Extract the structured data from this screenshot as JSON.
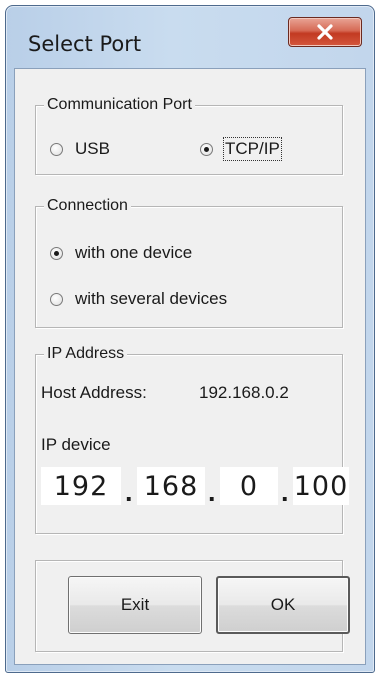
{
  "window": {
    "title": "Select Port"
  },
  "communication": {
    "legend": "Communication Port",
    "usb_label": "USB",
    "tcpip_label": "TCP/IP",
    "selected": "TCP/IP"
  },
  "connection": {
    "legend": "Connection",
    "one_device_label": "with one device",
    "several_devices_label": "with several devices",
    "selected": "with one device"
  },
  "ip_address": {
    "legend": "IP Address",
    "host_label": "Host Address:",
    "host_value": "192.168.0.2",
    "device_label": "IP device",
    "octets": [
      "192",
      "168",
      "0",
      "100"
    ],
    "separator": "."
  },
  "buttons": {
    "exit_label": "Exit",
    "ok_label": "OK"
  },
  "icons": {
    "close": "close-x-icon"
  },
  "colors": {
    "close_button": "#c8432b",
    "frame": "#c2d6ec",
    "client": "#f0f0f0"
  }
}
